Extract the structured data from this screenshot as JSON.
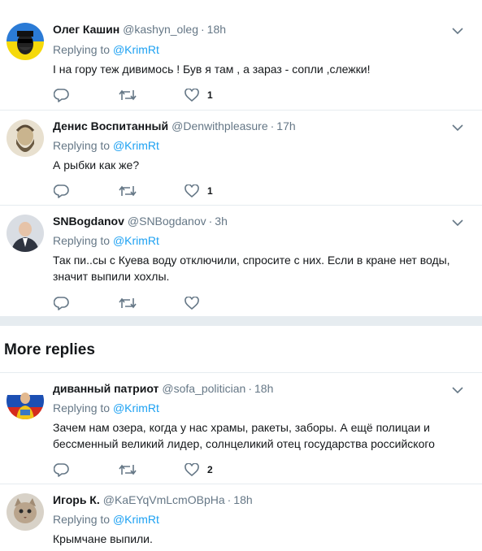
{
  "tweets": [
    {
      "name": "Олег Кашин",
      "handle": "@kashyn_oleg",
      "time": "18h",
      "replying_prefix": "Replying to",
      "replying_to": "@KrimRt",
      "text": "І на гору теж дивимось ! Був я там , а зараз - сопли ,слежки!",
      "likes": "1",
      "avatar_icon": "masked-face-ukraine-flag-avatar"
    },
    {
      "name": "Денис Воспитанный",
      "handle": "@Denwithpleasure",
      "time": "17h",
      "replying_prefix": "Replying to",
      "replying_to": "@KrimRt",
      "text": "А рыбки как же?",
      "likes": "1",
      "avatar_icon": "bearded-man-portrait-avatar"
    },
    {
      "name": "SNBogdanov",
      "handle": "@SNBogdanov",
      "time": "3h",
      "replying_prefix": "Replying to",
      "replying_to": "@KrimRt",
      "text": "Так пи..сы с Куева воду отключили, спросите с них. Если в кране нет воды, значит выпили хохлы.",
      "likes": "",
      "avatar_icon": "man-in-suit-avatar"
    }
  ],
  "more_replies_label": "More replies",
  "more_tweets": [
    {
      "name": "диванный патриот",
      "handle": "@sofa_politician",
      "time": "18h",
      "replying_prefix": "Replying to",
      "replying_to": "@KrimRt",
      "text": "Зачем нам озера, когда у нас храмы, ракеты, заборы. А ещё полицаи и бессменный великий лидер, солнцеликий отец государства российского",
      "likes": "2",
      "avatar_icon": "russian-flag-man-avatar"
    },
    {
      "name": "Игорь К.",
      "handle": "@KaEYqVmLcmOBpHa",
      "time": "18h",
      "replying_prefix": "Replying to",
      "replying_to": "@KrimRt",
      "text": "Крымчане выпили.",
      "likes": "",
      "avatar_icon": "cat-avatar"
    }
  ],
  "colors": {
    "accent": "#1da1f2",
    "secondary_text": "#657786",
    "divider": "#e6ecf0",
    "primary_text": "#14171a"
  }
}
